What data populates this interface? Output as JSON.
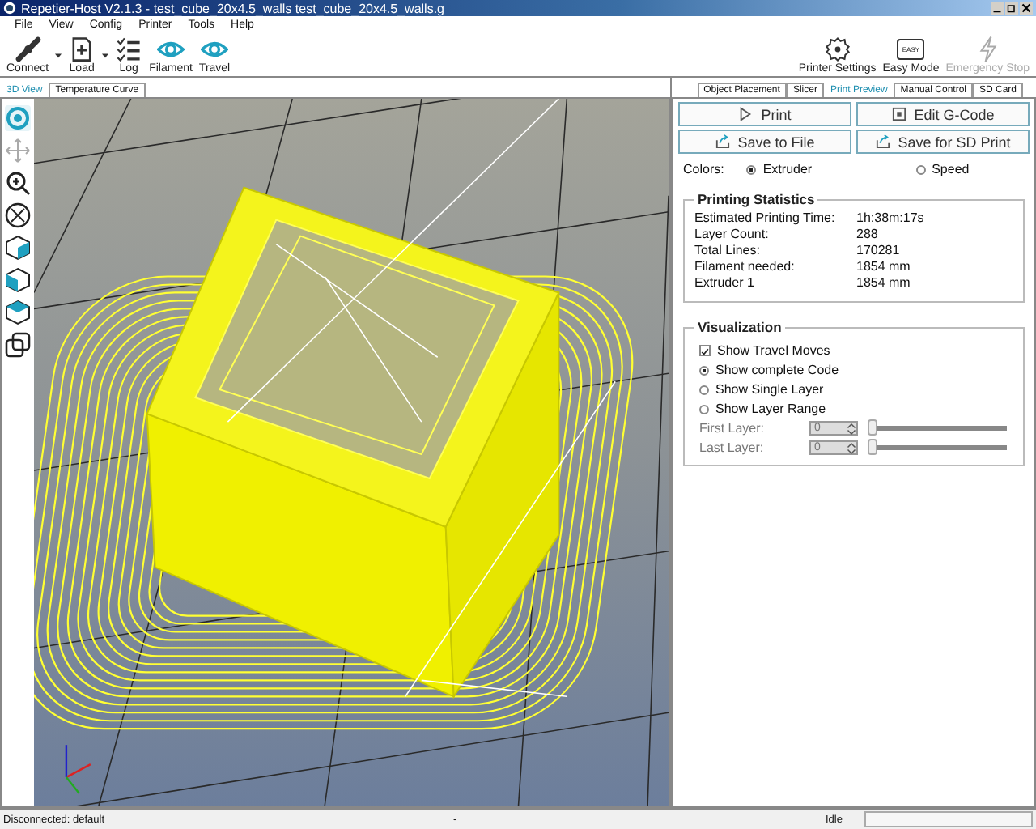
{
  "window": {
    "title": "Repetier-Host V2.1.3 - test_cube_20x4.5_walls test_cube_20x4.5_walls.g"
  },
  "menu": [
    "File",
    "View",
    "Config",
    "Printer",
    "Tools",
    "Help"
  ],
  "toolbar": [
    {
      "kind": "connect",
      "label": "Connect",
      "dropdown": true
    },
    {
      "kind": "load",
      "label": "Load",
      "dropdown": true
    },
    {
      "kind": "log",
      "label": "Log",
      "dropdown": false
    },
    {
      "kind": "eye",
      "label": "Filament",
      "dropdown": false
    },
    {
      "kind": "eye",
      "label": "Travel",
      "dropdown": false
    }
  ],
  "toolbar_right": [
    {
      "kind": "gear",
      "label": "Printer Settings",
      "disabled": false
    },
    {
      "kind": "easy",
      "label": "Easy Mode",
      "icon_text": "EASY",
      "disabled": false
    },
    {
      "kind": "bolt",
      "label": "Emergency Stop",
      "disabled": true
    }
  ],
  "left_tabs": [
    {
      "label": "3D View",
      "selected": true
    },
    {
      "label": "Temperature Curve",
      "selected": false
    }
  ],
  "view_tools": [
    {
      "kind": "rotate",
      "selected": true
    },
    {
      "kind": "move",
      "selected": false
    },
    {
      "kind": "zoom",
      "selected": false
    },
    {
      "kind": "fit",
      "selected": false
    },
    {
      "kind": "cube-front",
      "selected": false
    },
    {
      "kind": "cube-side",
      "selected": false
    },
    {
      "kind": "cube-top",
      "selected": false
    },
    {
      "kind": "layers",
      "selected": false
    }
  ],
  "right_tabs": [
    {
      "label": "Object Placement",
      "selected": false
    },
    {
      "label": "Slicer",
      "selected": false
    },
    {
      "label": "Print Preview",
      "selected": true
    },
    {
      "label": "Manual Control",
      "selected": false
    },
    {
      "label": "SD Card",
      "selected": false
    }
  ],
  "buttons": [
    {
      "kind": "play",
      "label": "Print"
    },
    {
      "kind": "edit",
      "label": "Edit G-Code"
    },
    {
      "kind": "export",
      "label": "Save to File"
    },
    {
      "kind": "export",
      "label": "Save for SD Print"
    }
  ],
  "colors": {
    "label": "Colors:",
    "options": [
      {
        "label": "Extruder",
        "selected": true
      },
      {
        "label": "Speed",
        "selected": false
      }
    ]
  },
  "statistics": {
    "title": "Printing Statistics",
    "rows": [
      {
        "label": "Estimated Printing Time:",
        "value": "1h:38m:17s"
      },
      {
        "label": "Layer Count:",
        "value": "288"
      },
      {
        "label": "Total Lines:",
        "value": "170281"
      },
      {
        "label": "Filament needed:",
        "value": "1854 mm"
      },
      {
        "label": "Extruder 1",
        "value": "1854 mm"
      }
    ]
  },
  "visualization": {
    "title": "Visualization",
    "options": [
      {
        "kind": "checkbox",
        "label": "Show Travel Moves",
        "checked": true
      },
      {
        "kind": "radio",
        "label": "Show complete Code",
        "selected": true
      },
      {
        "kind": "radio",
        "label": "Show Single Layer",
        "selected": false
      },
      {
        "kind": "radio",
        "label": "Show Layer Range",
        "selected": false
      }
    ],
    "layers": [
      {
        "label": "First Layer:",
        "value": "0",
        "level": 0,
        "disabled": true
      },
      {
        "label": "Last Layer:",
        "value": "0",
        "level": 0,
        "disabled": true
      }
    ]
  },
  "status_bar": {
    "connection": "Disconnected: default",
    "middle": "-",
    "state": "Idle",
    "level": 0
  }
}
